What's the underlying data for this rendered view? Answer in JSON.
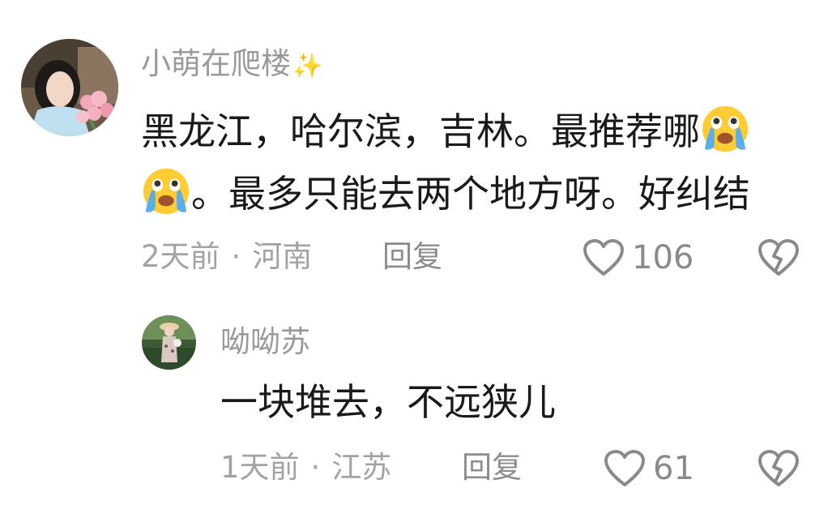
{
  "comments": [
    {
      "username": "小萌在爬楼",
      "username_suffix": "✨",
      "text_line1": "黑龙江，哈尔滨，吉林。最推荐哪",
      "text_line2": "。最多只能去两个地方呀。好纠结",
      "emoji": "loudly-crying-face-icon",
      "time": "2天前",
      "location": "河南",
      "reply_label": "回复",
      "like_count": "106"
    },
    {
      "username": "呦呦苏",
      "text_line1": "一块堆去，不远狭儿",
      "time": "1天前",
      "location": "江苏",
      "reply_label": "回复",
      "like_count": "61"
    }
  ],
  "separator": "·",
  "colors": {
    "username": "#9a9a9a",
    "text": "#1a1a1a",
    "meta": "#a3a3a3",
    "icon": "#8a8a8a"
  }
}
